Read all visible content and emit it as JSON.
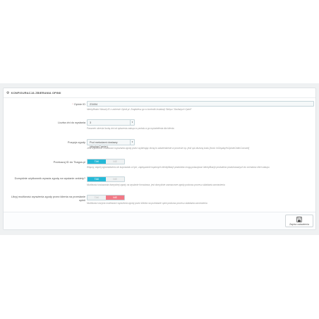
{
  "panel": {
    "heading": "Konfiguracja zbierania opinii",
    "heading_icon": "gear-icon"
  },
  "fields": {
    "merchant_id": {
      "label": "Opinie ID",
      "value": "23494",
      "help": "Identyfikator Waszej ID z zakresie Opinii.pl. Znajdziesz go w kontrolki instalacji Sklepu \"Zaufanych Opinii\""
    },
    "days_to_ship": {
      "label": "Liczba dni do wysłania",
      "value": "3",
      "help": "Parametr określa liczbę dni od opłacenia zakupu w portalu a go wyświetlenia dla klienta"
    },
    "consent_position": {
      "label": "Pozycja zgody",
      "value": "Pod metodami dostawy (displayCarrier)",
      "help": "Jeśli wybieraszt możliwości wyrażania zgody przez wybierając ikonę to zatwierdzenie w procesie np. jeśli opi złożoną kodu [hook: hrDisplayHrOpinieOrderConsent]"
    },
    "product_vat": {
      "label": "Przekazuj ID do Tkagus.pl",
      "yes": "TAK",
      "no": "NIE",
      "state": "yes",
      "help": "Włączy, więcej zgromadzeniu do kupowaniu w tym, zapisywanie kupionych identyfikacji produktów mogą pokazywać identyfikacje produktów produkowanych do ocenianiu ofert zakupu"
    },
    "confirm_usage": {
      "label": "Domyślnie użytkownik wyraża zgodę na wysłanie ankiety?",
      "yes": "TAK",
      "no": "NIE",
      "state": "yes",
      "help": "Możliwości wskazania domyślnej zgody na wysłanie formularza, jest domyślnie zaznaczone zgody podczas procesu składania zamówienia"
    },
    "allow_consent": {
      "label": "Ukryj możliwość wyrażenia zgody przez klienta na przesłanie opinii",
      "yes": "TAK",
      "no": "NIE",
      "state": "no",
      "help": "Możliwości ukrycia możliwości wyrażenia zgody przez klienta na przesłanie opini podczas procesu składania zamówienia"
    }
  },
  "footer": {
    "save_label": "Zapisz ustawienia",
    "save_icon": "floppy-disk-icon"
  },
  "colors": {
    "switch_yes": "#25b9d7",
    "switch_no": "#f27885",
    "background": "#eff1f2"
  }
}
